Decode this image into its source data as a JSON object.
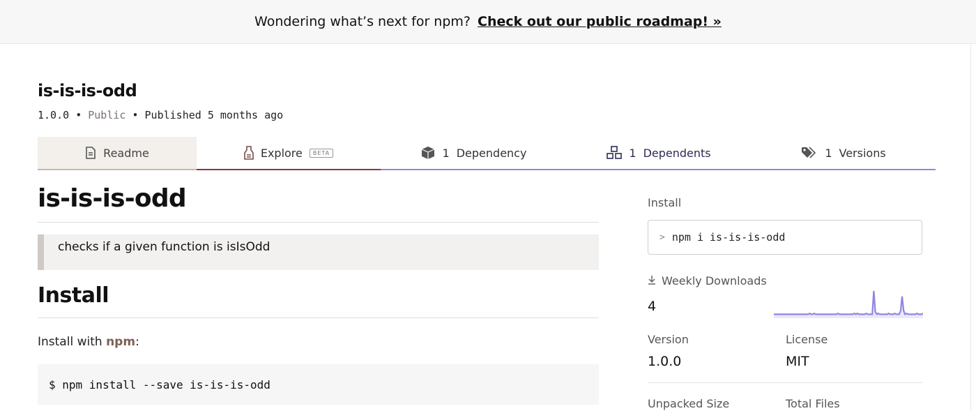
{
  "banner": {
    "text": "Wondering what’s next for npm?",
    "link": "Check out our public roadmap! »"
  },
  "package": {
    "name": "is-is-is-odd",
    "version": "1.0.0",
    "visibility": "Public",
    "published": "Published 5 months ago",
    "separator": "•"
  },
  "tabs": [
    {
      "label": "Readme",
      "icon": "readme-icon"
    },
    {
      "label": "Explore",
      "icon": "explore-icon",
      "badge": "BETA"
    },
    {
      "count": "1",
      "label": "Dependency",
      "icon": "box-icon"
    },
    {
      "count": "1",
      "label": "Dependents",
      "icon": "boxes-icon"
    },
    {
      "count": "1",
      "label": "Versions",
      "icon": "tags-icon"
    }
  ],
  "readme": {
    "title": "is-is-is-odd",
    "quote": "checks if a given function is isIsOdd",
    "install_heading": "Install",
    "install_with_prefix": "Install with ",
    "install_with_link": "npm",
    "install_with_suffix": ":",
    "code": "$ npm install --save is-is-is-odd"
  },
  "sidebar": {
    "install_label": "Install",
    "install_prompt": ">",
    "install_command": "npm i is-is-is-odd",
    "weekly_label": "Weekly Downloads",
    "weekly_count": "4",
    "weekly_series": [
      2,
      2,
      2,
      2,
      2,
      2,
      2,
      2,
      2,
      2,
      2,
      2,
      2,
      2,
      2,
      2,
      2,
      2,
      2,
      2,
      2,
      2,
      2,
      2,
      3,
      2,
      2,
      3,
      2,
      2,
      2,
      2,
      2,
      2,
      2,
      2,
      2,
      2,
      2,
      2,
      2,
      2,
      2,
      3,
      2,
      2,
      2,
      2,
      2,
      2,
      2,
      2,
      2,
      2,
      3,
      2,
      3,
      2,
      2,
      2,
      2,
      2,
      3,
      2,
      2,
      2,
      2,
      28,
      5,
      2,
      3,
      2,
      2,
      2,
      2,
      2,
      2,
      3,
      2,
      2,
      2,
      3,
      2,
      2,
      2,
      6,
      22,
      6,
      2,
      3,
      2,
      2,
      2,
      2,
      2,
      2,
      3,
      2,
      2,
      2,
      3
    ],
    "version_label": "Version",
    "version_value": "1.0.0",
    "license_label": "License",
    "license_value": "MIT",
    "unpacked_label": "Unpacked Size",
    "files_label": "Total Files"
  },
  "colors": {
    "accent": "#8f86e0",
    "sparkline": "#8f86e0",
    "explore_underline": "#8a3a3a",
    "npm_link": "#7b6156"
  }
}
